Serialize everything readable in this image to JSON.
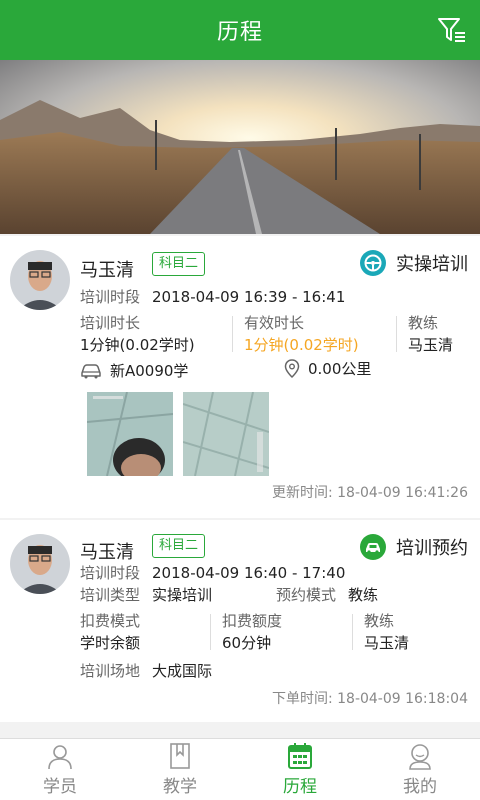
{
  "header": {
    "title": "历程"
  },
  "records": [
    {
      "name": "马玉清",
      "subject_tag": "科目二",
      "type_label": "实操培训",
      "period_label": "培训时段",
      "period_value": "2018-04-09 16:39 - 16:41",
      "stats": [
        {
          "key": "培训时长",
          "value": "1分钟(0.02学时)"
        },
        {
          "key": "有效时长",
          "value": "1分钟(0.02学时)"
        },
        {
          "key": "教练",
          "value": "马玉清"
        }
      ],
      "plate": "新A0090学",
      "distance": "0.00公里",
      "updated_label": "更新时间:",
      "updated_value": "18-04-09  16:41:26"
    },
    {
      "name": "马玉清",
      "subject_tag": "科目二",
      "type_label": "培训预约",
      "period_label": "培训时段",
      "period_value": "2018-04-09 16:40 - 17:40",
      "training_type_label": "培训类型",
      "training_type_value": "实操培训",
      "booking_mode_label": "预约模式",
      "booking_mode_value": "教练",
      "stats": [
        {
          "key": "扣费模式",
          "value": "学时余额"
        },
        {
          "key": "扣费额度",
          "value": "60分钟"
        },
        {
          "key": "教练",
          "value": "马玉清"
        }
      ],
      "venue_label": "培训场地",
      "venue_value": "大成国际",
      "order_label": "下单时间:",
      "order_value": "18-04-09  16:18:04"
    }
  ],
  "tabs": [
    {
      "label": "学员",
      "icon": "student-icon",
      "active": false
    },
    {
      "label": "教学",
      "icon": "book-icon",
      "active": false
    },
    {
      "label": "历程",
      "icon": "calendar-icon",
      "active": true
    },
    {
      "label": "我的",
      "icon": "profile-icon",
      "active": false
    }
  ],
  "colors": {
    "brand": "#2aa83a",
    "accent_orange": "#f5a623",
    "teal": "#1aa8b8"
  }
}
